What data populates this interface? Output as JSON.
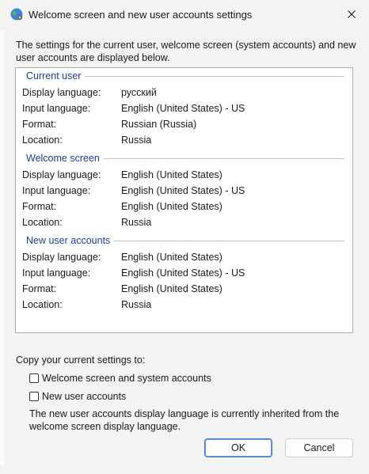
{
  "window": {
    "title": "Welcome screen and new user accounts settings",
    "icon": "globe-gear-icon",
    "close_icon": "close-icon"
  },
  "intro": "The settings for the current user, welcome screen (system accounts) and new user accounts are displayed below.",
  "sections": [
    {
      "heading": "Current user",
      "rows": [
        {
          "label": "Display language:",
          "value": "русский"
        },
        {
          "label": "Input language:",
          "value": "English (United States) - US"
        },
        {
          "label": "Format:",
          "value": "Russian (Russia)"
        },
        {
          "label": "Location:",
          "value": "Russia"
        }
      ]
    },
    {
      "heading": "Welcome screen",
      "rows": [
        {
          "label": "Display language:",
          "value": "English (United States)"
        },
        {
          "label": "Input language:",
          "value": "English (United States) - US"
        },
        {
          "label": "Format:",
          "value": "English (United States)"
        },
        {
          "label": "Location:",
          "value": "Russia"
        }
      ]
    },
    {
      "heading": "New user accounts",
      "rows": [
        {
          "label": "Display language:",
          "value": "English (United States)"
        },
        {
          "label": "Input language:",
          "value": "English (United States) - US"
        },
        {
          "label": "Format:",
          "value": "English (United States)"
        },
        {
          "label": "Location:",
          "value": "Russia"
        }
      ]
    }
  ],
  "copy": {
    "label": "Copy your current settings to:",
    "options": [
      {
        "label": "Welcome screen and system accounts",
        "checked": false
      },
      {
        "label": "New user accounts",
        "checked": false
      }
    ],
    "note": "The new user accounts display language is currently inherited from the welcome screen display language."
  },
  "buttons": {
    "ok": "OK",
    "cancel": "Cancel"
  },
  "colors": {
    "section_heading": "#1f3a93",
    "primary_button_border": "#3f79d3"
  }
}
